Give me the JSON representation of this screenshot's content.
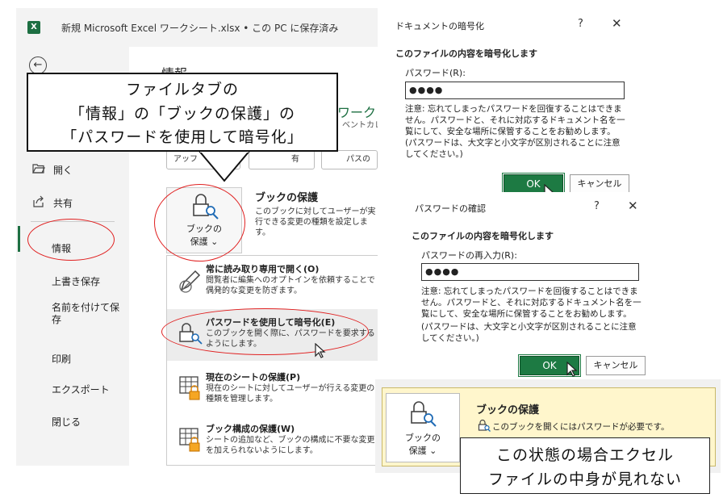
{
  "excel": {
    "window_title": "新規 Microsoft Excel ワークシート.xlsx • この PC に保存済み",
    "app_logo": "X",
    "nav": {
      "items": [
        {
          "label": "開く",
          "icon": "folder-open-icon"
        },
        {
          "label": "共有",
          "icon": "share-icon"
        },
        {
          "label": "情報"
        },
        {
          "label": "上書き保存"
        },
        {
          "label": "名前を付けて保存"
        },
        {
          "label": "印刷"
        },
        {
          "label": "エクスポート"
        },
        {
          "label": "閉じる"
        }
      ]
    },
    "main": {
      "title": "情報",
      "workbook_name_fragment": "ワーク",
      "workbook_path_fragment": "ベントカレ",
      "toolbar_pills": [
        "アッフ",
        "有",
        "パスの"
      ],
      "protect_button_label": [
        "ブックの",
        "保護 ⌄"
      ],
      "protect_heading": "ブックの保護",
      "protect_description": "このブックに対してユーザーが実行できる変更の種類を設定しま す。"
    },
    "dropdown": [
      {
        "title": "常に読み取り専用で開く(O)",
        "desc": "閲覧者に編集へのオプトインを依頼することで偶発的な変更を防ぎます。",
        "icon": "pencil-slash-icon"
      },
      {
        "title": "パスワードを使用して暗号化(E)",
        "desc": "このブックを開く際に、パスワードを要求するようにします。",
        "icon": "lock-key-icon"
      },
      {
        "title": "現在のシートの保護(P)",
        "desc": "現在のシートに対してユーザーが行える変更の種類を管理します。",
        "icon": "sheet-lock-icon"
      },
      {
        "title": "ブック構成の保護(W)",
        "desc": "シートの追加など、ブックの構成に不要な変更を加えられないようにします。",
        "icon": "structure-lock-icon"
      }
    ]
  },
  "callout": {
    "lines": [
      "ファイルタブの",
      "「情報」の「ブックの保護」の",
      "「パスワードを使用して暗号化」"
    ]
  },
  "dialog_encrypt": {
    "title": "ドキュメントの暗号化",
    "help": "?",
    "close": "✕",
    "heading": "このファイルの内容を暗号化します",
    "field_label": "パスワード(R):",
    "field_value": "●●●●",
    "note": [
      "注意: 忘れてしまったパスワードを回復することはできません。パスワードと、それに対応するドキュメント名を一覧にして、安全な場所に保管することをお勧めします。",
      "(パスワードは、大文字と小文字が区別されることに注意してください。)"
    ],
    "ok": "OK",
    "cancel": "キャンセル"
  },
  "dialog_confirm": {
    "title": "パスワードの確認",
    "help": "?",
    "close": "✕",
    "heading": "このファイルの内容を暗号化します",
    "field_label": "パスワードの再入力(R):",
    "field_value": "●●●●",
    "note": [
      "注意: 忘れてしまったパスワードを回復することはできません。パスワードと、それに対応するドキュメント名を一覧にして、安全な場所に保管することをお勧めします。",
      "(パスワードは、大文字と小文字が区別されることに注意してください。)"
    ],
    "ok": "OK",
    "cancel": "キャンセル"
  },
  "result": {
    "button_label": [
      "ブックの",
      "保護 ⌄"
    ],
    "heading": "ブックの保護",
    "description": "このブックを開くにはパスワードが必要です。"
  },
  "note_box": {
    "lines": [
      "この状態の場合エクセル",
      "ファイルの中身が見れない"
    ]
  },
  "colors": {
    "excel_green": "#1d6f42",
    "ok_button": "#1d7a43",
    "highlight_red": "#e02020",
    "result_yellow": "#fff6cc"
  }
}
